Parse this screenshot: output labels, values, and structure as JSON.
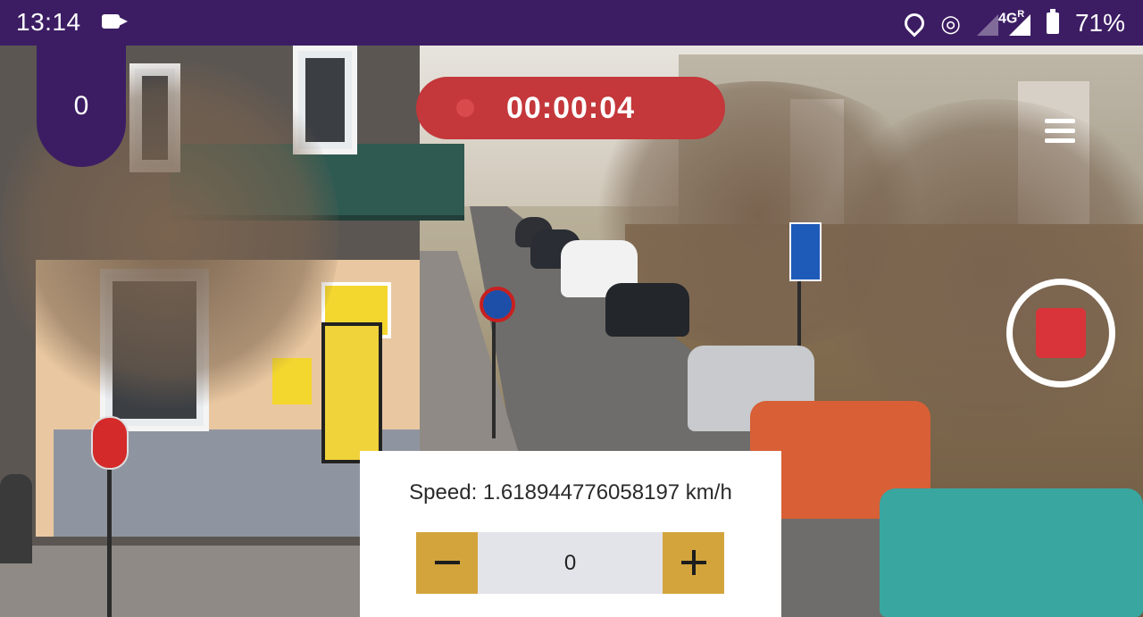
{
  "status_bar": {
    "time": "13:14",
    "icons": [
      "video-camera-icon",
      "location-icon",
      "hotspot-icon",
      "signal-icon",
      "battery-icon"
    ],
    "network": "4G",
    "roaming": "R",
    "battery": "71%"
  },
  "counter": {
    "value": "0"
  },
  "recording": {
    "elapsed": "00:00:04",
    "color": "#c4373a"
  },
  "menu": {
    "icon": "hamburger-menu-icon"
  },
  "stop_button": {
    "icon": "stop-icon",
    "color": "#d8343a"
  },
  "speed_panel": {
    "speed_text": "Speed: 1.618944776058197 km/h",
    "stepper_value": "0",
    "minus_icon": "minus-icon",
    "plus_icon": "plus-icon",
    "button_color": "#d3a43c"
  },
  "theme": {
    "primary": "#3c1d63"
  }
}
